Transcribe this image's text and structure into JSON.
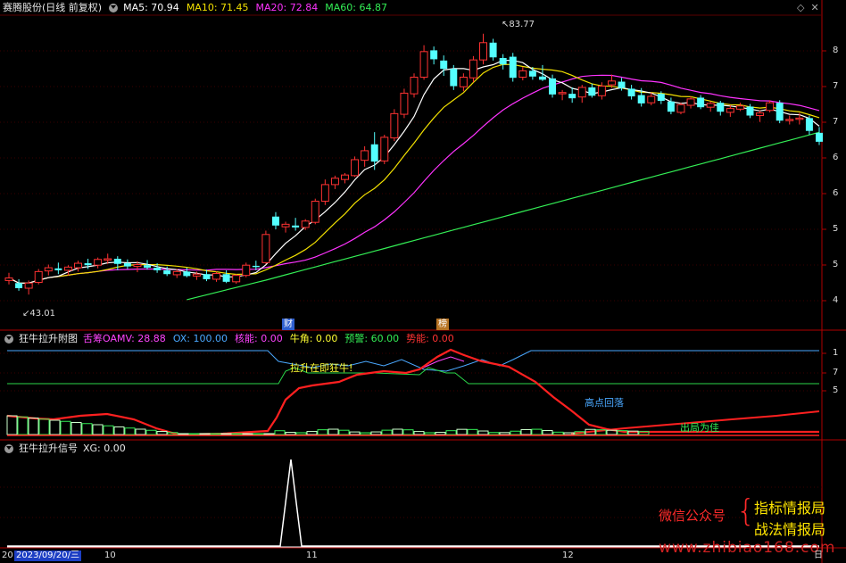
{
  "price_panel": {
    "stock_title": "赛腾股份(日线 前复权)",
    "ma": [
      {
        "label": "MA5: 70.94",
        "color": "#ffffff"
      },
      {
        "label": "MA10: 71.45",
        "color": "#f2e000"
      },
      {
        "label": "MA20: 72.84",
        "color": "#ff33ff"
      },
      {
        "label": "MA60: 64.87",
        "color": "#33ee55"
      }
    ],
    "high_label": "83.77",
    "low_label": "43.01",
    "markers": [
      {
        "text": "财",
        "color": "#3a78ff"
      },
      {
        "text": "榜",
        "color": "#c8822a"
      }
    ],
    "right_ticks": [
      "8",
      "7",
      "7",
      "6",
      "6",
      "5",
      "5",
      "4"
    ],
    "corner_icons": [
      "diamond-icon",
      "close-icon"
    ]
  },
  "indicator_panel": {
    "title": "狂牛拉升附图",
    "values": [
      {
        "label": "舌筹OAMV: 28.88",
        "color": "#ff44ff"
      },
      {
        "label": "OX: 100.00",
        "color": "#4aa8ff"
      },
      {
        "label": "核能: 0.00",
        "color": "#ff44ff"
      },
      {
        "label": "牛角: 0.00",
        "color": "#ffff33"
      },
      {
        "label": "预警: 60.00",
        "color": "#33ee55"
      },
      {
        "label": "势能: 0.00",
        "color": "#ff3333"
      }
    ],
    "annotations": {
      "rise": "拉升在即狂牛!",
      "fall": "高点回落",
      "exit": "出局为佳"
    },
    "right_ticks": [
      "1",
      "7",
      "5"
    ]
  },
  "signal_panel": {
    "title": "狂牛拉升信号",
    "value": "XG: 0.00"
  },
  "watermark": {
    "wechat": "微信公众号",
    "line1": "指标情报局",
    "line2": "战法情报局",
    "site": "www.zhibiao168.com"
  },
  "date_axis": {
    "prefix": "20",
    "selected": "2023/09/20/三",
    "ticks": [
      "10",
      "11",
      "12"
    ],
    "end": "日"
  },
  "chart_data": {
    "type": "candlestick",
    "title": "赛腾股份(日线 前复权)",
    "y_range_approx": [
      43.01,
      83.77
    ],
    "notes": "Daily candles rising from ~43.01 low to 83.77 peak then consolidating ~70-75; cyan = down candles, red = up candles",
    "candles_ohlc": [
      [
        45.2,
        46.4,
        44.6,
        45.6
      ],
      [
        44.8,
        45.4,
        43.6,
        44.0
      ],
      [
        44.0,
        45.2,
        43.0,
        44.8
      ],
      [
        44.9,
        47.0,
        44.6,
        46.6
      ],
      [
        46.7,
        47.7,
        46.0,
        47.2
      ],
      [
        47.1,
        48.0,
        46.2,
        46.8
      ],
      [
        46.8,
        47.6,
        46.0,
        47.3
      ],
      [
        47.2,
        48.3,
        46.6,
        47.9
      ],
      [
        47.9,
        48.6,
        47.0,
        47.6
      ],
      [
        47.6,
        48.8,
        47.1,
        48.5
      ],
      [
        48.4,
        49.4,
        47.8,
        48.6
      ],
      [
        48.6,
        49.0,
        46.8,
        47.8
      ],
      [
        47.9,
        48.5,
        47.0,
        47.4
      ],
      [
        47.4,
        48.2,
        46.5,
        47.7
      ],
      [
        47.6,
        48.4,
        46.9,
        47.2
      ],
      [
        47.2,
        47.9,
        46.4,
        46.8
      ],
      [
        46.8,
        47.4,
        45.9,
        46.2
      ],
      [
        46.1,
        47.0,
        45.6,
        46.6
      ],
      [
        46.6,
        47.2,
        45.7,
        45.9
      ],
      [
        45.9,
        46.6,
        45.3,
        46.2
      ],
      [
        46.2,
        46.9,
        45.1,
        45.4
      ],
      [
        45.4,
        46.6,
        45.0,
        46.3
      ],
      [
        46.2,
        46.8,
        44.8,
        45.0
      ],
      [
        45.0,
        46.2,
        44.7,
        46.0
      ],
      [
        46.0,
        48.0,
        45.7,
        47.6
      ],
      [
        47.5,
        48.3,
        46.8,
        47.3
      ],
      [
        48.0,
        53.0,
        47.8,
        52.4
      ],
      [
        55.2,
        55.9,
        53.2,
        53.8
      ],
      [
        53.6,
        54.4,
        52.7,
        54.0
      ],
      [
        53.8,
        55.0,
        53.0,
        53.5
      ],
      [
        53.5,
        54.8,
        53.1,
        54.5
      ],
      [
        54.3,
        58.0,
        54.0,
        57.6
      ],
      [
        57.6,
        61.0,
        57.0,
        60.2
      ],
      [
        60.2,
        61.6,
        59.5,
        61.2
      ],
      [
        61.0,
        62.0,
        60.4,
        61.7
      ],
      [
        61.6,
        64.6,
        61.4,
        64.1
      ],
      [
        64.0,
        66.2,
        63.0,
        65.5
      ],
      [
        66.5,
        68.4,
        62.5,
        63.8
      ],
      [
        63.9,
        68.0,
        63.4,
        67.6
      ],
      [
        67.5,
        72.0,
        67.0,
        71.3
      ],
      [
        71.2,
        75.2,
        70.6,
        74.5
      ],
      [
        74.4,
        77.6,
        73.8,
        77.0
      ],
      [
        77.0,
        82.0,
        76.6,
        81.0
      ],
      [
        81.2,
        81.8,
        79.0,
        79.8
      ],
      [
        79.6,
        80.4,
        77.2,
        78.3
      ],
      [
        78.3,
        78.9,
        75.0,
        75.6
      ],
      [
        75.5,
        77.6,
        74.8,
        77.0
      ],
      [
        76.9,
        80.3,
        76.2,
        79.7
      ],
      [
        79.7,
        83.8,
        79.0,
        82.4
      ],
      [
        82.4,
        83.0,
        79.6,
        80.1
      ],
      [
        80.0,
        80.6,
        78.2,
        79.0
      ],
      [
        80.2,
        80.8,
        76.3,
        76.9
      ],
      [
        77.0,
        78.6,
        76.5,
        78.0
      ],
      [
        78.0,
        78.6,
        76.6,
        77.1
      ],
      [
        77.1,
        78.9,
        76.4,
        76.6
      ],
      [
        76.8,
        77.4,
        73.8,
        74.3
      ],
      [
        74.4,
        75.0,
        73.4,
        74.6
      ],
      [
        74.4,
        75.4,
        73.0,
        73.7
      ],
      [
        73.9,
        75.8,
        73.0,
        75.4
      ],
      [
        75.4,
        76.0,
        73.8,
        74.1
      ],
      [
        74.1,
        76.2,
        73.5,
        75.6
      ],
      [
        75.8,
        77.4,
        75.3,
        76.4
      ],
      [
        76.3,
        76.9,
        74.9,
        75.3
      ],
      [
        75.2,
        75.8,
        73.5,
        74.0
      ],
      [
        74.2,
        75.3,
        72.4,
        72.9
      ],
      [
        73.0,
        74.6,
        72.6,
        74.0
      ],
      [
        74.4,
        74.8,
        72.8,
        73.3
      ],
      [
        73.2,
        73.8,
        71.2,
        71.6
      ],
      [
        71.5,
        73.0,
        71.2,
        72.7
      ],
      [
        72.6,
        74.0,
        72.1,
        73.6
      ],
      [
        73.8,
        74.2,
        72.0,
        72.3
      ],
      [
        72.3,
        73.2,
        71.6,
        72.9
      ],
      [
        73.0,
        73.3,
        71.0,
        71.6
      ],
      [
        71.5,
        72.6,
        70.8,
        72.1
      ],
      [
        72.0,
        73.0,
        71.7,
        72.5
      ],
      [
        72.4,
        72.8,
        70.6,
        71.0
      ],
      [
        71.0,
        71.8,
        70.0,
        71.4
      ],
      [
        71.8,
        73.4,
        71.5,
        73.0
      ],
      [
        73.0,
        73.4,
        69.8,
        70.2
      ],
      [
        70.2,
        71.0,
        69.6,
        70.4
      ],
      [
        70.4,
        71.4,
        69.6,
        70.6
      ],
      [
        70.6,
        71.0,
        68.0,
        68.6
      ],
      [
        68.3,
        69.2,
        66.4,
        66.9
      ]
    ]
  }
}
